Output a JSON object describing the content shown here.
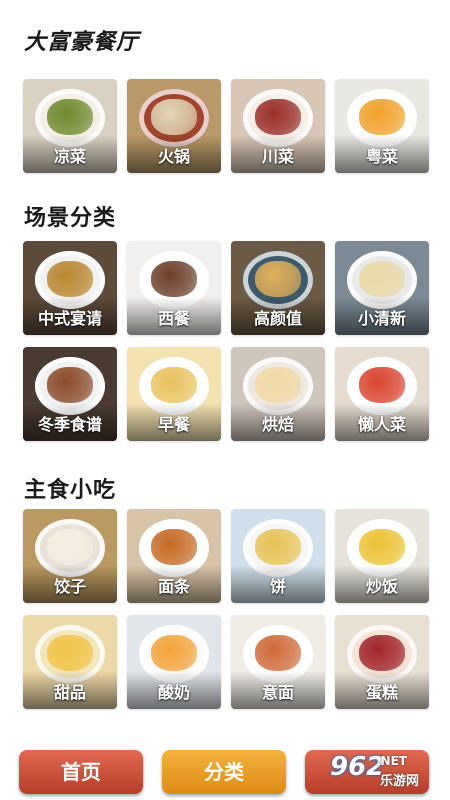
{
  "sections": [
    {
      "title": "大富豪餐厅",
      "items": [
        {
          "label": "凉菜",
          "bg": "#d9d2c2",
          "plate": "#f3efe6",
          "food": "#6f8a2e"
        },
        {
          "label": "火锅",
          "bg": "#b89a6a",
          "plate": "#a1452e",
          "food": "#e2d6b8"
        },
        {
          "label": "川菜",
          "bg": "#d8c7b6",
          "plate": "#f5efe8",
          "food": "#9a2e2a"
        },
        {
          "label": "粤菜",
          "bg": "#e9e7e2",
          "plate": "#ffffff",
          "food": "#f0a12b"
        }
      ]
    },
    {
      "title": "场景分类",
      "items": [
        {
          "label": "中式宴请",
          "bg": "#5c4a3a",
          "plate": "#f2f2f2",
          "food": "#b8862f"
        },
        {
          "label": "西餐",
          "bg": "#f0efee",
          "plate": "#ffffff",
          "food": "#6a3f2a"
        },
        {
          "label": "高颜值",
          "bg": "#6b5a45",
          "plate": "#3c5a6a",
          "food": "#e0b05a"
        },
        {
          "label": "小清新",
          "bg": "#7c8a96",
          "plate": "#e9e9e9",
          "food": "#e9d9a8"
        },
        {
          "label": "冬季食谱",
          "bg": "#4a3b32",
          "plate": "#f1f1f1",
          "food": "#8a4b2c"
        },
        {
          "label": "早餐",
          "bg": "#f3e3b3",
          "plate": "#ffffff",
          "food": "#e8c25e"
        },
        {
          "label": "烘焙",
          "bg": "#cfc6bd",
          "plate": "#efe9e2",
          "food": "#f0d9a6"
        },
        {
          "label": "懒人菜",
          "bg": "#e6dcd0",
          "plate": "#ffffff",
          "food": "#d9442f"
        }
      ]
    },
    {
      "title": "主食小吃",
      "items": [
        {
          "label": "饺子",
          "bg": "#b99a63",
          "plate": "#e8e2d8",
          "food": "#f3ede2"
        },
        {
          "label": "面条",
          "bg": "#d8c4a8",
          "plate": "#ffffff",
          "food": "#c56a24"
        },
        {
          "label": "饼",
          "bg": "#cfe0ea",
          "plate": "#f6f6f6",
          "food": "#e6c257"
        },
        {
          "label": "炒饭",
          "bg": "#e6e3dc",
          "plate": "#ffffff",
          "food": "#ecc235"
        },
        {
          "label": "甜品",
          "bg": "#ecd8a8",
          "plate": "#f2e6bc",
          "food": "#f1c44a"
        },
        {
          "label": "酸奶",
          "bg": "#e2e6ea",
          "plate": "#fbfbfb",
          "food": "#f3a23a"
        },
        {
          "label": "意面",
          "bg": "#efece6",
          "plate": "#ffffff",
          "food": "#cf6a3a"
        },
        {
          "label": "蛋糕",
          "bg": "#e9e0d4",
          "plate": "#f5e4d6",
          "food": "#a0242c"
        }
      ]
    }
  ],
  "nav": {
    "home": "首页",
    "category": "分类"
  },
  "watermark": {
    "number": "962",
    "brand": ".NET",
    "brand_cn": "乐游网"
  }
}
